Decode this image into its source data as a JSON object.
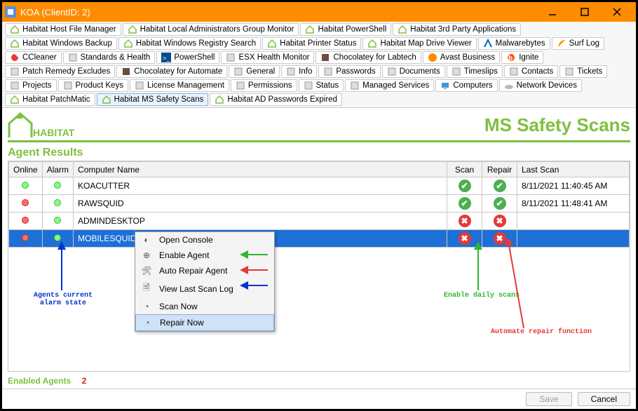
{
  "window": {
    "title": "KOA   (ClientID: 2)"
  },
  "toolbar": {
    "rows": [
      [
        "Habitat Host File Manager",
        "Habitat Local Administrators Group Monitor",
        "Habitat PowerShell",
        "Habitat 3rd Party Applications",
        "Habitat Windows Backup"
      ],
      [
        "Habitat Windows Registry Search",
        "Habitat Printer Status",
        "Habitat Map Drive Viewer",
        "Malwarebytes",
        "Surf Log",
        "CCleaner",
        "Standards & Health"
      ],
      [
        "PowerShell",
        "ESX Health Monitor",
        "Chocolatey for Labtech",
        "Avast Business",
        "Ignite",
        "Patch Remedy Excludes",
        "Chocolatey for Automate"
      ],
      [
        "General",
        "Info",
        "Passwords",
        "Documents",
        "Timeslips",
        "Contacts",
        "Tickets",
        "Projects",
        "Product Keys",
        "License Management",
        "Permissions",
        "Status"
      ],
      [
        "Managed Services",
        "Computers",
        "Network Devices",
        "Habitat PatchMatic",
        "Habitat MS Safety Scans",
        "Habitat AD Passwords Expired"
      ]
    ],
    "active": "Habitat MS Safety Scans"
  },
  "page": {
    "title": "MS Safety Scans",
    "section": "Agent Results"
  },
  "columns": {
    "online": "Online",
    "alarm": "Alarm",
    "computer": "Computer Name",
    "scan": "Scan",
    "repair": "Repair",
    "last": "Last Scan"
  },
  "rows": [
    {
      "online": "green",
      "alarm": "green",
      "computer": "KOACUTTER",
      "scan": "ok",
      "repair": "ok",
      "last": "8/11/2021 11:40:45 AM"
    },
    {
      "online": "red",
      "alarm": "green",
      "computer": "RAWSQUID",
      "scan": "ok",
      "repair": "ok",
      "last": "8/11/2021 11:48:41 AM"
    },
    {
      "online": "red",
      "alarm": "green",
      "computer": "ADMINDESKTOP",
      "scan": "err",
      "repair": "err",
      "last": ""
    },
    {
      "online": "red",
      "alarm": "green",
      "computer": "MOBILESQUID",
      "scan": "err",
      "repair": "err",
      "last": "",
      "selected": true
    }
  ],
  "context_menu": [
    {
      "icon": "console",
      "label": "Open Console"
    },
    {
      "icon": "plus",
      "label": "Enable Agent"
    },
    {
      "icon": "wrench",
      "label": "Auto Repair Agent"
    },
    {
      "icon": "doc",
      "label": "View Last Scan Log"
    },
    {
      "icon": "clock",
      "label": "Scan Now"
    },
    {
      "icon": "clock",
      "label": "Repair Now",
      "highlight": true
    }
  ],
  "annotations": {
    "alarm": "Agents current\nalarm state",
    "scans": "Enable daily scans",
    "repair": "Automate repair function"
  },
  "footer": {
    "label": "Enabled Agents",
    "count": "2",
    "save": "Save",
    "cancel": "Cancel"
  }
}
